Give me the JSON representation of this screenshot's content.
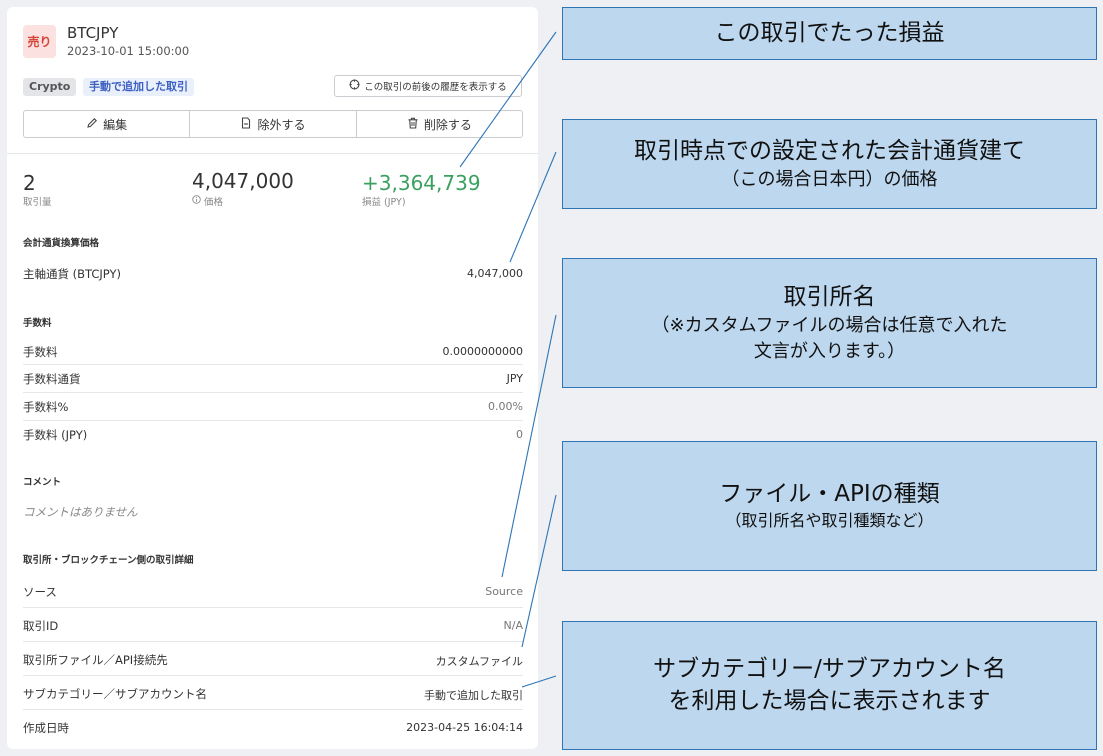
{
  "trade": {
    "side_badge": "売り",
    "pair": "BTCJPY",
    "datetime": "2023-10-01 15:00:00",
    "tags": [
      "Crypto",
      "手動で追加した取引"
    ],
    "history_button": "この取引の前後の履歴を表示する",
    "actions": {
      "edit": "編集",
      "exclude": "除外する",
      "delete": "削除する"
    },
    "summary": [
      {
        "value": "2",
        "label": "取引量"
      },
      {
        "value": "4,047,000",
        "label": "価格"
      },
      {
        "value": "+3,364,739",
        "label": "損益 (JPY)"
      }
    ]
  },
  "sections": {
    "converted_price": {
      "title": "会計通貨換算価格",
      "rows": [
        {
          "label": "主軸通貨 (BTCJPY)",
          "value": "4,047,000"
        }
      ]
    },
    "fees": {
      "title": "手数料",
      "rows": [
        {
          "label": "手数料",
          "value": "0.0000000000"
        },
        {
          "label": "手数料通貨",
          "value": "JPY"
        },
        {
          "label": "手数料%",
          "value": "0.00%"
        },
        {
          "label": "手数料 (JPY)",
          "value": "0"
        }
      ]
    },
    "comment": {
      "title": "コメント",
      "empty_text": "コメントはありません"
    },
    "exchange_details": {
      "title": "取引所・ブロックチェーン側の取引詳細",
      "rows": [
        {
          "label": "ソース",
          "value": "Source"
        },
        {
          "label": "取引ID",
          "value": "N/A"
        },
        {
          "label": "取引所ファイル／API接続先",
          "value": "カスタムファイル"
        },
        {
          "label": "サブカテゴリー／サブアカウント名",
          "value": "手動で追加した取引"
        },
        {
          "label": "作成日時",
          "value": "2023-04-25 16:04:14"
        }
      ]
    }
  },
  "callouts": [
    {
      "lines": [
        "この取引でたった損益"
      ]
    },
    {
      "lines": [
        "取引時点での設定された会計通貨建て",
        "（この場合日本円）の価格"
      ]
    },
    {
      "lines": [
        "取引所名",
        "（※カスタムファイルの場合は任意で入れた",
        "文言が入ります。）"
      ]
    },
    {
      "lines": [
        "ファイル・APIの種類",
        "（取引所名や取引種類など）"
      ]
    },
    {
      "lines": [
        "サブカテゴリー/サブアカウント名",
        "を利用した場合に表示されます"
      ]
    }
  ],
  "colors": {
    "sell": "#d6443a",
    "profit": "#3aa060",
    "callout_fill": "#bdd7ee",
    "callout_border": "#2e75b6"
  }
}
